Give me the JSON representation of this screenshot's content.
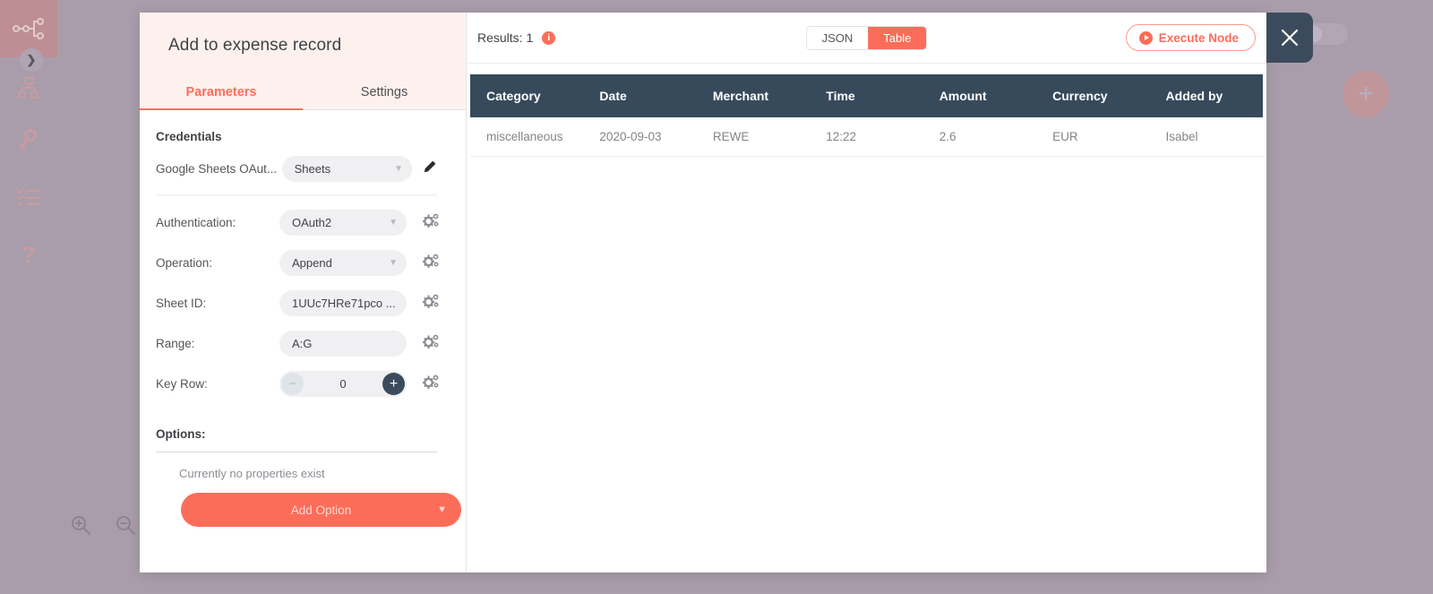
{
  "sidebar": {
    "logo_icon": "workflow-nodes-icon",
    "expand_icon": "chevron-right-icon",
    "items": [
      {
        "icon": "workflows-hierarchy-icon",
        "name": "workflows"
      },
      {
        "icon": "key-icon",
        "name": "credentials"
      },
      {
        "icon": "executions-list-icon",
        "name": "executions"
      },
      {
        "icon": "question-mark-icon",
        "name": "help"
      }
    ]
  },
  "canvas": {
    "zoom_in_icon": "zoom-in-icon",
    "zoom_out_icon": "zoom-out-icon",
    "add_node_label": "+"
  },
  "ndv": {
    "title": "Add to expense record",
    "close_label": "✕",
    "tabs": [
      {
        "label": "Parameters",
        "active": true
      },
      {
        "label": "Settings",
        "active": false
      }
    ],
    "credentials": {
      "section_title": "Credentials",
      "label": "Google Sheets OAut...",
      "value": "Sheets",
      "edit_icon": "pencil-icon"
    },
    "parameters": [
      {
        "label": "Authentication:",
        "value": "OAuth2",
        "type": "select"
      },
      {
        "label": "Operation:",
        "value": "Append",
        "type": "select"
      },
      {
        "label": "Sheet ID:",
        "value": "1UUc7HRe71pco ...",
        "type": "text"
      },
      {
        "label": "Range:",
        "value": "A:G",
        "type": "text"
      },
      {
        "label": "Key Row:",
        "value": "0",
        "type": "stepper"
      }
    ],
    "options": {
      "title": "Options:",
      "empty_text": "Currently no properties exist",
      "add_label": "Add Option",
      "add_caret": "⌄"
    }
  },
  "output": {
    "results_label": "Results: 1",
    "info_icon": "info-icon",
    "info_glyph": "i",
    "display_modes": [
      {
        "label": "JSON",
        "active": false
      },
      {
        "label": "Table",
        "active": true
      }
    ],
    "execute_label": "Execute Node",
    "execute_icon": "play-icon",
    "table": {
      "columns": [
        "Category",
        "Date",
        "Merchant",
        "Time",
        "Amount",
        "Currency",
        "Added by"
      ],
      "rows": [
        [
          "miscellaneous",
          "2020-09-03",
          "REWE",
          "12:22",
          "2.6",
          "EUR",
          "Isabel"
        ]
      ]
    }
  },
  "colors": {
    "accent": "#fb6d59",
    "dark": "#374a5c",
    "backdrop": "#a99dab",
    "tab_bg": "#fdf1ee"
  }
}
